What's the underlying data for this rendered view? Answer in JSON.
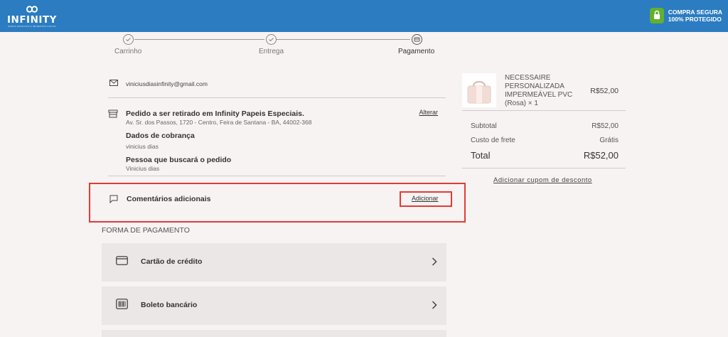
{
  "header": {
    "logo_text": "INFINITY",
    "logo_sub": "PAPEIS ESPECIAIS E IMPRESSÃO DIGITAL",
    "secure_line1": "COMPRA SEGURA",
    "secure_line2": "100% PROTEGIDO"
  },
  "steps": [
    {
      "label": "Carrinho",
      "state": "done"
    },
    {
      "label": "Entrega",
      "state": "done"
    },
    {
      "label": "Pagamento",
      "state": "active"
    }
  ],
  "email": "viniciusdiasinfinity@gmail.com",
  "pickup": {
    "title": "Pedido a ser retirado em Infinity Papeis Especiais.",
    "address": "Av. Sr. dos Passos, 1720 - Centro, Feira de Santana - BA, 44002-368",
    "change_label": "Alterar",
    "billing_title": "Dados de cobrança",
    "billing_name": "vinicius dias",
    "pickup_person_title": "Pessoa que buscará o pedido",
    "pickup_person_name": "Vinicius dias"
  },
  "comments": {
    "label": "Comentários adicionais",
    "add_label": "Adicionar"
  },
  "payment": {
    "section_title": "FORMA DE PAGAMENTO",
    "methods": [
      {
        "label": "Cartão de crédito",
        "icon": "credit-card-icon"
      },
      {
        "label": "Boleto bancário",
        "icon": "barcode-icon"
      }
    ]
  },
  "cart": {
    "product_name": "NECESSAIRE PERSONALIZADA IMPERMEÁVEL PVC (Rosa) × 1",
    "product_price": "R$52,00",
    "subtotal_label": "Subtotal",
    "subtotal_value": "R$52,00",
    "shipping_label": "Custo de frete",
    "shipping_value": "Grátis",
    "total_label": "Total",
    "total_value": "R$52,00",
    "coupon_label": "Adicionar cupom de desconto"
  },
  "colors": {
    "header_bg": "#2b7cc0",
    "secure_green": "#63b02f",
    "highlight_red": "#e53935",
    "page_bg": "#f7f3f2",
    "card_bg": "#ebe7e6"
  }
}
